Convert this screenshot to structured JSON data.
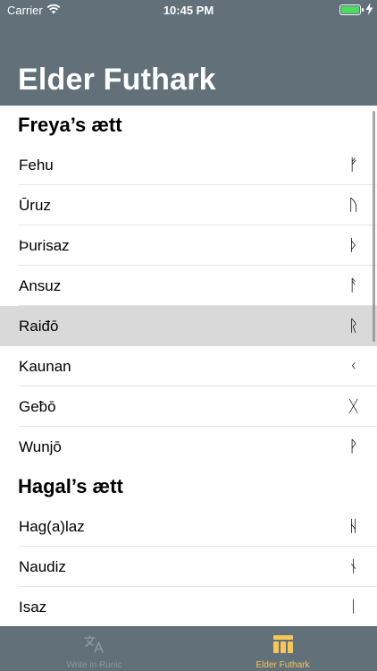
{
  "status_bar": {
    "carrier": "Carrier",
    "time": "10:45 PM"
  },
  "nav": {
    "title": "Elder Futhark"
  },
  "sections": [
    {
      "title": "Freya’s ætt"
    },
    {
      "title": "Hagal’s ætt"
    }
  ],
  "rows": [
    {
      "name": "Fehu",
      "rune": "ᚠ"
    },
    {
      "name": "Ūruz",
      "rune": "ᚢ"
    },
    {
      "name": "Þurisaz",
      "rune": "ᚦ"
    },
    {
      "name": "Ansuz",
      "rune": "ᚨ"
    },
    {
      "name": "Raiđō",
      "rune": "ᚱ"
    },
    {
      "name": "Kaunan",
      "rune": "ᚲ"
    },
    {
      "name": "Geƀō",
      "rune": "ᚷ"
    },
    {
      "name": "Wunjō",
      "rune": "ᚹ"
    },
    {
      "name": "Hag(a)laz",
      "rune": "ᚺ"
    },
    {
      "name": "Naudiz",
      "rune": "ᚾ"
    },
    {
      "name": "Isaz",
      "rune": "ᛁ"
    }
  ],
  "selected_row": "Raiđō",
  "tabbar": {
    "tabs": [
      {
        "label": "Write in Runic",
        "icon": "translate-icon",
        "selected": false
      },
      {
        "label": "Elder Futhark",
        "icon": "columns-icon",
        "selected": true
      }
    ]
  },
  "colors": {
    "bar": "#617079",
    "accent": "#f7c65a",
    "selected_row": "#d9d9d9",
    "battery": "#4cd964"
  }
}
